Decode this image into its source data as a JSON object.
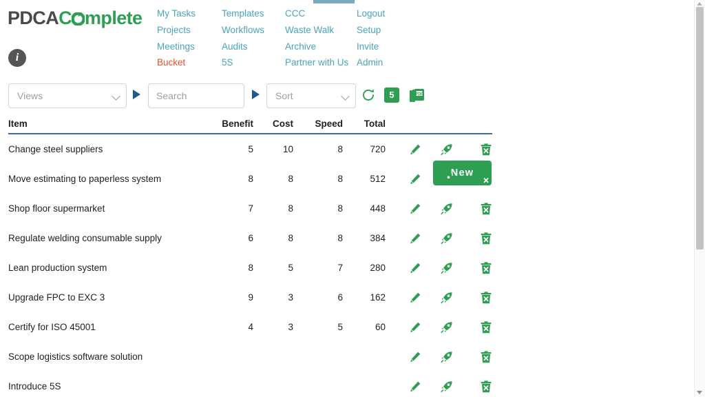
{
  "logo": {
    "part1": "PDCA",
    "part2_pre": "C",
    "part2_post": "mplete",
    "cycle_icon": "pdca-cycle-icon",
    "color_dark": "#4a4a4a",
    "color_green": "#2e9e53"
  },
  "info": {
    "icon": "info-icon",
    "label": "i"
  },
  "nav": {
    "link_color": "#4aa3b8",
    "active_color": "#e2502a",
    "columns": [
      {
        "items": [
          {
            "label": "My Tasks",
            "active": false
          },
          {
            "label": "Projects",
            "active": false
          },
          {
            "label": "Meetings",
            "active": false
          },
          {
            "label": "Bucket",
            "active": true
          }
        ]
      },
      {
        "items": [
          {
            "label": "Templates",
            "active": false
          },
          {
            "label": "Workflows",
            "active": false
          },
          {
            "label": "Audits",
            "active": false
          },
          {
            "label": "5S",
            "active": false
          }
        ]
      },
      {
        "items": [
          {
            "label": "CCC",
            "active": false
          },
          {
            "label": "Waste Walk",
            "active": false
          },
          {
            "label": "Archive",
            "active": false
          },
          {
            "label": "Partner with Us",
            "active": false
          }
        ]
      },
      {
        "items": [
          {
            "label": "Logout",
            "active": false
          },
          {
            "label": "Setup",
            "active": false
          },
          {
            "label": "Invite",
            "active": false
          },
          {
            "label": "Admin",
            "active": false
          }
        ]
      }
    ]
  },
  "toolbar": {
    "views_value": "Views",
    "search_placeholder": "Search",
    "search_value": "",
    "sort_value": "Sort",
    "refresh_icon": "refresh-icon",
    "count_badge": "5",
    "pdf_icon": "pdf-export-icon",
    "new_label": "New",
    "play_icon": "play-triangle-icon",
    "accent_green": "#2e9e53",
    "accent_blue": "#1c5a8f"
  },
  "table": {
    "headers": {
      "item": "Item",
      "benefit": "Benefit",
      "cost": "Cost",
      "speed": "Speed",
      "total": "Total"
    },
    "rows": [
      {
        "item": "Change steel suppliers",
        "benefit": "5",
        "cost": "10",
        "speed": "8",
        "total": "720"
      },
      {
        "item": "Move estimating to paperless system",
        "benefit": "8",
        "cost": "8",
        "speed": "8",
        "total": "512"
      },
      {
        "item": "Shop floor supermarket",
        "benefit": "7",
        "cost": "8",
        "speed": "8",
        "total": "448"
      },
      {
        "item": "Regulate welding consumable supply",
        "benefit": "6",
        "cost": "8",
        "speed": "8",
        "total": "384"
      },
      {
        "item": "Lean production system",
        "benefit": "8",
        "cost": "5",
        "speed": "7",
        "total": "280"
      },
      {
        "item": "Upgrade FPC to EXC 3",
        "benefit": "9",
        "cost": "3",
        "speed": "6",
        "total": "162"
      },
      {
        "item": "Certify for ISO 45001",
        "benefit": "4",
        "cost": "3",
        "speed": "5",
        "total": "60"
      },
      {
        "item": "Scope logistics software solution",
        "benefit": "",
        "cost": "",
        "speed": "",
        "total": ""
      },
      {
        "item": "Introduce 5S",
        "benefit": "",
        "cost": "",
        "speed": "",
        "total": ""
      }
    ],
    "action_icons": [
      "edit-pencil-icon",
      "rocket-launch-icon",
      "delete-trash-icon"
    ],
    "icon_color": "#2e9e53",
    "header_rule_color": "#3f6f96"
  }
}
